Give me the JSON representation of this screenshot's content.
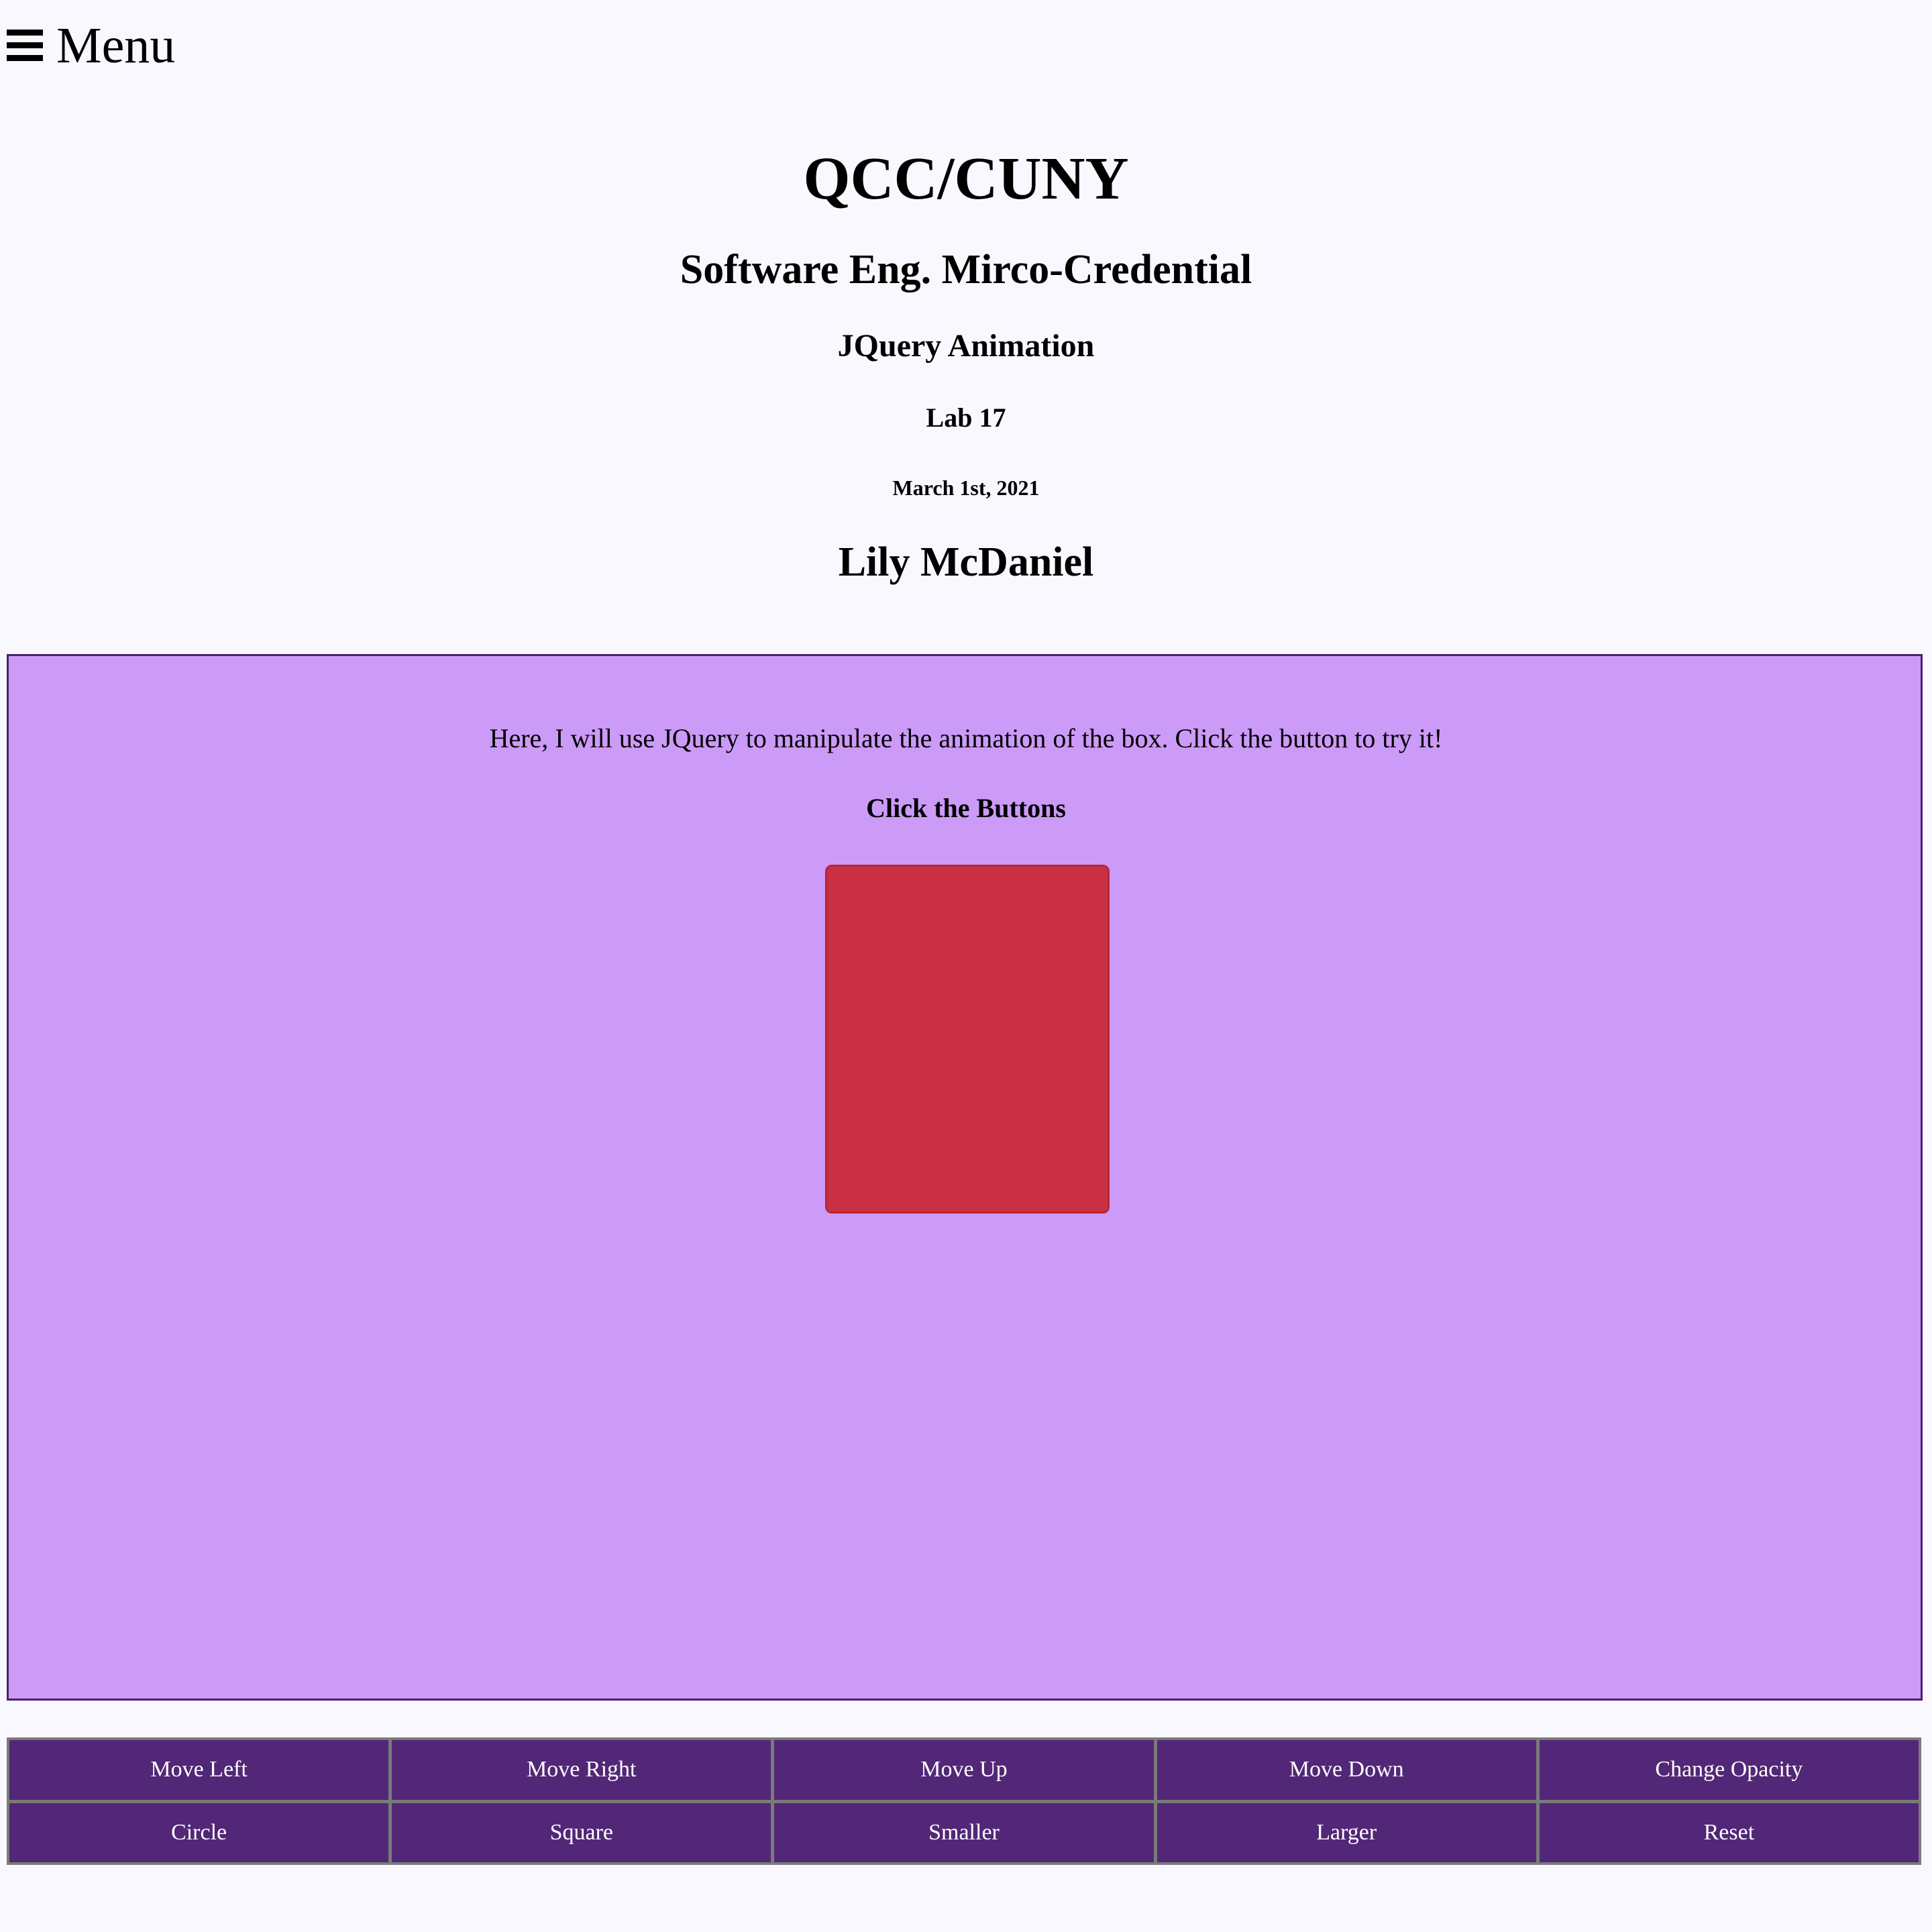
{
  "menu": {
    "label": "Menu"
  },
  "header": {
    "school": "QCC/CUNY",
    "program": "Software Eng. Mirco-Credential",
    "topic": "JQuery Animation",
    "lab": "Lab 17",
    "date": "March 1st, 2021",
    "author": "Lily McDaniel"
  },
  "stage": {
    "description": "Here, I will use JQuery to manipulate the animation of the box. Click the button to try it!",
    "heading": "Click the Buttons",
    "background_color": "#cc9af7",
    "box_color": "#c93044"
  },
  "controls": {
    "button_color": "#522777",
    "buttons": [
      {
        "label": "Move Left"
      },
      {
        "label": "Move Right"
      },
      {
        "label": "Move Up"
      },
      {
        "label": "Move Down"
      },
      {
        "label": "Change Opacity"
      },
      {
        "label": "Circle"
      },
      {
        "label": "Square"
      },
      {
        "label": "Smaller"
      },
      {
        "label": "Larger"
      },
      {
        "label": "Reset"
      }
    ]
  }
}
